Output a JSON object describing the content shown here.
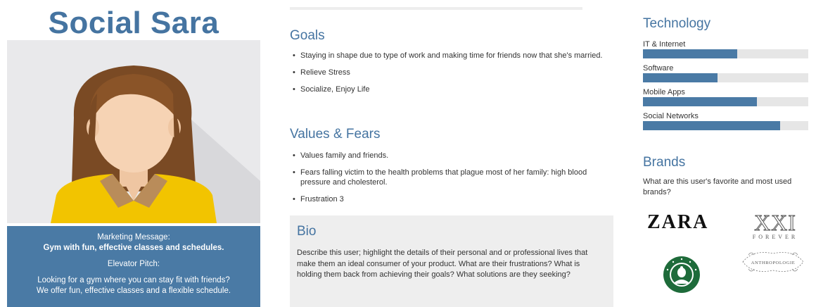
{
  "persona": {
    "name": "Social Sara",
    "marketing_label": "Marketing Message:",
    "marketing_text": "Gym with fun, effective classes and schedules.",
    "pitch_label": "Elevator Pitch:",
    "pitch_line1": "Looking for a gym where you can stay fit with friends?",
    "pitch_line2": "We offer fun, effective classes and a flexible schedule."
  },
  "goals": {
    "heading": "Goals",
    "items": [
      "Staying in shape due to type of work and making time for friends now that she's married.",
      "Relieve Stress",
      "Socialize, Enjoy Life"
    ]
  },
  "values": {
    "heading": "Values & Fears",
    "items": [
      "Values family and friends.",
      "Fears falling victim to the health problems that plague most of her family: high blood pressure and cholesterol.",
      "Frustration 3"
    ]
  },
  "bio": {
    "heading": "Bio",
    "text": "Describe this user; highlight the details of their personal and or professional lives that make them an ideal consumer of your product. What are their frustrations? What is holding them back from achieving their goals? What solutions are they seeking?"
  },
  "technology": {
    "heading": "Technology",
    "items": [
      {
        "label": "IT & Internet",
        "level": 0.57
      },
      {
        "label": "Software",
        "level": 0.45
      },
      {
        "label": "Mobile Apps",
        "level": 0.69
      },
      {
        "label": "Social Networks",
        "level": 0.83
      }
    ],
    "bar_color": "#4a7aa5",
    "track_color": "#e6e6e6"
  },
  "brands": {
    "heading": "Brands",
    "description": "What are this user's favorite and most used brands?",
    "zara": "ZARA",
    "xxi_big": "XXI",
    "xxi_small": "FOREVER",
    "starbucks": "STARBUCKS",
    "anthropologie": "ANTHROPOLOGIE"
  },
  "colors": {
    "accent": "#4574a1",
    "panel": "#4a7aa5",
    "portrait_bg": "#e9e9eb"
  }
}
